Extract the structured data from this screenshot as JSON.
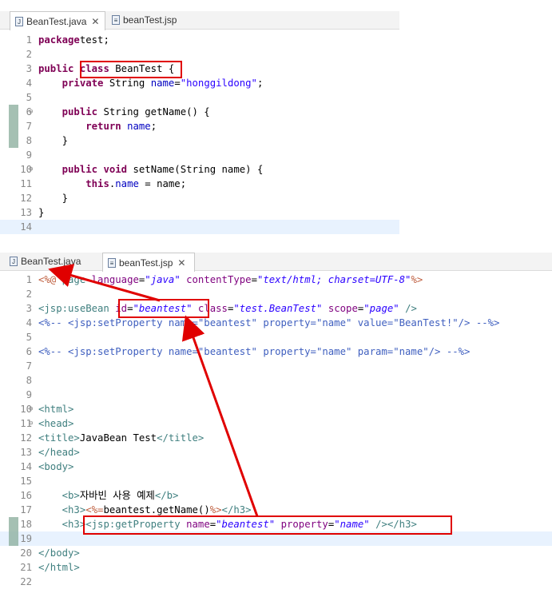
{
  "java_editor": {
    "tabs": [
      {
        "label": "BeanTest.java",
        "close": "✕"
      },
      {
        "label": "beanTest.jsp"
      }
    ],
    "lines": [
      {
        "n": "1",
        "segs": [
          [
            "kw",
            "package"
          ],
          [
            "",
            "test;"
          ]
        ]
      },
      {
        "n": "2",
        "segs": []
      },
      {
        "n": "3",
        "segs": [
          [
            "kw",
            "public"
          ],
          [
            "",
            " "
          ],
          [
            "kw",
            "class"
          ],
          [
            "",
            " BeanTest {"
          ]
        ]
      },
      {
        "n": "4",
        "segs": [
          [
            "",
            "    "
          ],
          [
            "kw",
            "private"
          ],
          [
            "",
            " String "
          ],
          [
            "field",
            "name"
          ],
          [
            "",
            "="
          ],
          [
            "str",
            "\"honggildong\""
          ],
          [
            "",
            ";"
          ]
        ]
      },
      {
        "n": "5",
        "segs": []
      },
      {
        "n": "6",
        "segs": [
          [
            "",
            "    "
          ],
          [
            "kw",
            "public"
          ],
          [
            "",
            " String getName() {"
          ]
        ]
      },
      {
        "n": "7",
        "segs": [
          [
            "",
            "        "
          ],
          [
            "kw",
            "return"
          ],
          [
            "",
            " "
          ],
          [
            "field",
            "name"
          ],
          [
            "",
            ";"
          ]
        ]
      },
      {
        "n": "8",
        "segs": [
          [
            "",
            "    }"
          ]
        ]
      },
      {
        "n": "9",
        "segs": []
      },
      {
        "n": "10",
        "segs": [
          [
            "",
            "    "
          ],
          [
            "kw",
            "public"
          ],
          [
            "",
            " "
          ],
          [
            "kw",
            "void"
          ],
          [
            "",
            " setName(String name) {"
          ]
        ]
      },
      {
        "n": "11",
        "segs": [
          [
            "",
            "        "
          ],
          [
            "kw",
            "this"
          ],
          [
            "",
            "."
          ],
          [
            "field",
            "name"
          ],
          [
            "",
            " = name;"
          ]
        ]
      },
      {
        "n": "12",
        "segs": [
          [
            "",
            "    }"
          ]
        ]
      },
      {
        "n": "13",
        "segs": [
          [
            "",
            "}"
          ]
        ]
      },
      {
        "n": "14",
        "segs": []
      }
    ]
  },
  "jsp_editor": {
    "tabs": [
      {
        "label": "BeanTest.java"
      },
      {
        "label": "beanTest.jsp",
        "close": "✕"
      }
    ],
    "lines": [
      {
        "n": "1",
        "segs": [
          [
            "dir",
            "<%@ "
          ],
          [
            "tag",
            "page "
          ],
          [
            "attr",
            "language"
          ],
          [
            "",
            "="
          ],
          [
            "aval",
            "\"java\""
          ],
          [
            "",
            " "
          ],
          [
            "attr",
            "contentType"
          ],
          [
            "",
            "="
          ],
          [
            "aval",
            "\"text/html; charset=UTF-8\""
          ],
          [
            "dir",
            "%>"
          ]
        ]
      },
      {
        "n": "2",
        "segs": []
      },
      {
        "n": "3",
        "segs": [
          [
            "tag",
            "<jsp:useBean "
          ],
          [
            "attr",
            "id"
          ],
          [
            "",
            "="
          ],
          [
            "aval",
            "\"beantest\""
          ],
          [
            "",
            " "
          ],
          [
            "attr",
            "class"
          ],
          [
            "",
            "="
          ],
          [
            "aval",
            "\"test.BeanTest\""
          ],
          [
            "",
            " "
          ],
          [
            "attr",
            "scope"
          ],
          [
            "",
            "="
          ],
          [
            "aval",
            "\"page\""
          ],
          [
            "",
            " "
          ],
          [
            "tag",
            "/>"
          ]
        ]
      },
      {
        "n": "4",
        "segs": [
          [
            "cmt",
            "<%-- <jsp:setProperty name=\"beantest\" property=\"name\" value=\"BeanTest!\"/> --%>"
          ]
        ]
      },
      {
        "n": "5",
        "segs": []
      },
      {
        "n": "6",
        "segs": [
          [
            "cmt",
            "<%-- <jsp:setProperty name=\"beantest\" property=\"name\" param=\"name\"/> --%>"
          ]
        ]
      },
      {
        "n": "7",
        "segs": []
      },
      {
        "n": "8",
        "segs": []
      },
      {
        "n": "9",
        "segs": []
      },
      {
        "n": "10",
        "segs": [
          [
            "tag",
            "<html>"
          ]
        ]
      },
      {
        "n": "11",
        "segs": [
          [
            "tag",
            "<head>"
          ]
        ]
      },
      {
        "n": "12",
        "segs": [
          [
            "tag",
            "<title>"
          ],
          [
            "",
            "JavaBean Test"
          ],
          [
            "tag",
            "</title>"
          ]
        ]
      },
      {
        "n": "13",
        "segs": [
          [
            "tag",
            "</head>"
          ]
        ]
      },
      {
        "n": "14",
        "segs": [
          [
            "tag",
            "<body>"
          ]
        ]
      },
      {
        "n": "15",
        "segs": []
      },
      {
        "n": "16",
        "segs": [
          [
            "",
            "    "
          ],
          [
            "tag",
            "<b>"
          ],
          [
            "",
            "자바빈 사용 예제"
          ],
          [
            "tag",
            "</b>"
          ]
        ]
      },
      {
        "n": "17",
        "segs": [
          [
            "",
            "    "
          ],
          [
            "tag",
            "<h3>"
          ],
          [
            "dir",
            "<%="
          ],
          [
            "",
            "beantest.getName()"
          ],
          [
            "dir",
            "%>"
          ],
          [
            "tag",
            "</h3>"
          ]
        ]
      },
      {
        "n": "18",
        "segs": [
          [
            "",
            "    "
          ],
          [
            "tag",
            "<h3>"
          ],
          [
            "tag",
            "<jsp:getProperty "
          ],
          [
            "attr",
            "name"
          ],
          [
            "",
            "="
          ],
          [
            "aval",
            "\"beantest\""
          ],
          [
            "",
            " "
          ],
          [
            "attr",
            "property"
          ],
          [
            "",
            "="
          ],
          [
            "aval",
            "\"name\""
          ],
          [
            "",
            " "
          ],
          [
            "tag",
            "/>"
          ],
          [
            "tag",
            "</h3>"
          ]
        ]
      },
      {
        "n": "19",
        "segs": []
      },
      {
        "n": "20",
        "segs": [
          [
            "tag",
            "</body>"
          ]
        ]
      },
      {
        "n": "21",
        "segs": [
          [
            "tag",
            "</html>"
          ]
        ]
      },
      {
        "n": "22",
        "segs": []
      }
    ]
  },
  "annotation_color": "#e00000"
}
